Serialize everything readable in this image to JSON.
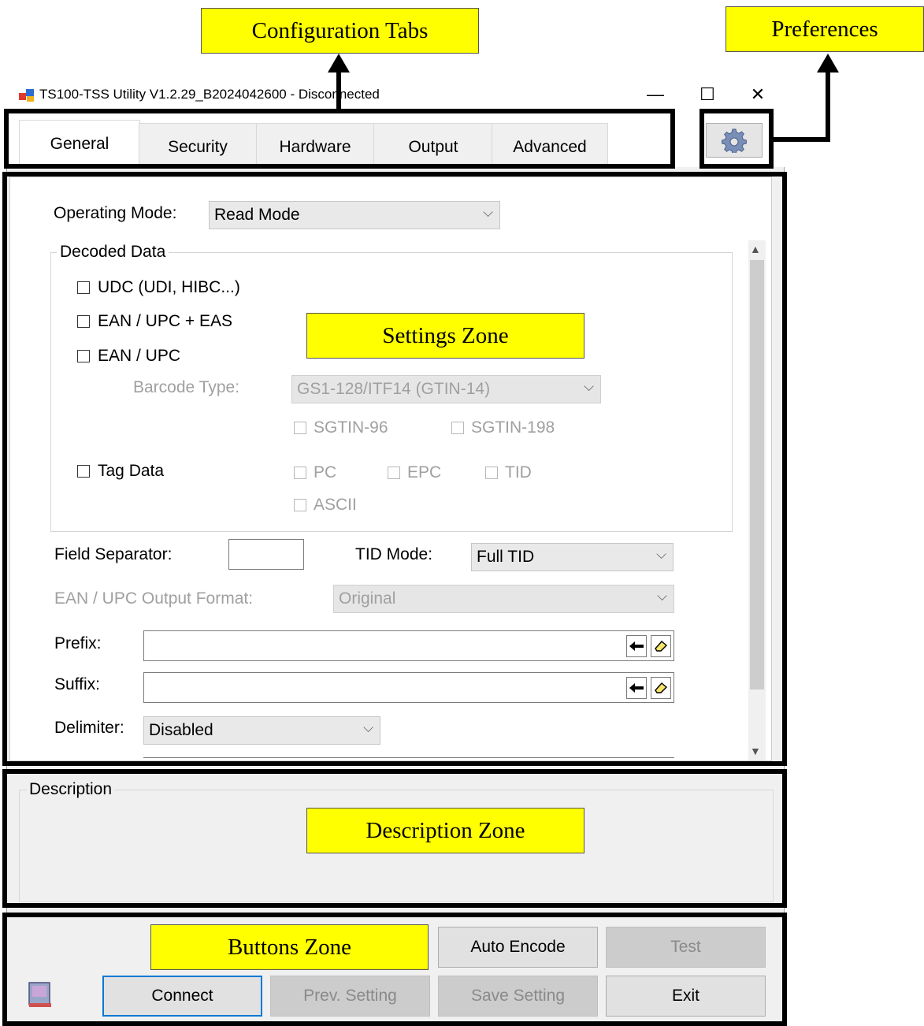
{
  "callouts": {
    "configuration_tabs": "Configuration Tabs",
    "preferences": "Preferences",
    "settings_zone": "Settings Zone",
    "description_zone": "Description Zone",
    "buttons_zone": "Buttons Zone"
  },
  "window": {
    "title": "TS100-TSS Utility V1.2.29_B2024042600 - Disconnected",
    "controls": {
      "minimize": "—",
      "maximize": "☐",
      "close": "✕"
    },
    "preferences_icon": "gear-icon"
  },
  "tabs": [
    {
      "label": "General",
      "active": true
    },
    {
      "label": "Security",
      "active": false
    },
    {
      "label": "Hardware",
      "active": false
    },
    {
      "label": "Output",
      "active": false
    },
    {
      "label": "Advanced",
      "active": false
    }
  ],
  "settings": {
    "operating_mode_label": "Operating Mode:",
    "operating_mode_value": "Read Mode",
    "decoded_data_group": "Decoded Data",
    "udc_label": "UDC (UDI, HIBC...)",
    "ean_upc_eas_label": "EAN / UPC + EAS",
    "ean_upc_label": "EAN / UPC",
    "barcode_type_label": "Barcode Type:",
    "barcode_type_value": "GS1-128/ITF14 (GTIN-14)",
    "sgtin96_label": "SGTIN-96",
    "sgtin198_label": "SGTIN-198",
    "tag_data_label": "Tag Data",
    "pc_label": "PC",
    "epc_label": "EPC",
    "tid_label": "TID",
    "ascii_label": "ASCII",
    "field_separator_label": "Field Separator:",
    "field_separator_value": "",
    "tid_mode_label": "TID Mode:",
    "tid_mode_value": "Full TID",
    "ean_output_format_label": "EAN / UPC Output Format:",
    "ean_output_format_value": "Original",
    "prefix_label": "Prefix:",
    "prefix_value": "",
    "suffix_label": "Suffix:",
    "suffix_value": "",
    "delimiter_label": "Delimiter:",
    "delimiter_value": "Disabled"
  },
  "description": {
    "group_label": "Description",
    "text": ""
  },
  "buttons": {
    "auto_encode": "Auto Encode",
    "test": "Test",
    "connect": "Connect",
    "prev_setting": "Prev. Setting",
    "save_setting": "Save Setting",
    "exit": "Exit"
  }
}
